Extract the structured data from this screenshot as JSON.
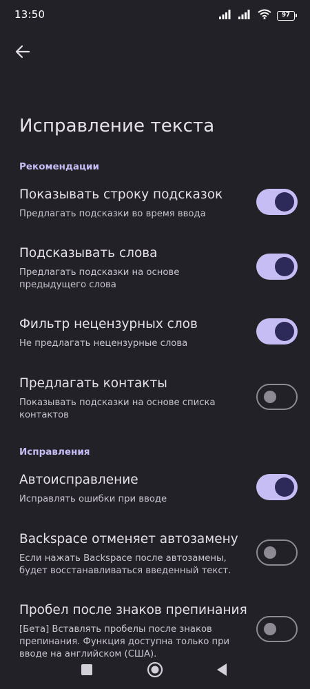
{
  "status_bar": {
    "time": "13:50",
    "battery": "97",
    "icons": [
      "signal-icon",
      "signal-icon",
      "wifi-icon",
      "battery-icon"
    ]
  },
  "header": {
    "back_icon": "arrow-left-icon",
    "title": "Исправление текста"
  },
  "sections": [
    {
      "header": "Рекомендации",
      "items": [
        {
          "title": "Показывать строку подсказок",
          "subtitle": "Предлагать подсказки во время ввода",
          "enabled": true
        },
        {
          "title": "Подсказывать слова",
          "subtitle": "Предлагать подсказки на основе предыдущего слова",
          "enabled": true
        },
        {
          "title": "Фильтр нецензурных слов",
          "subtitle": "Не предлагать нецензурные слова",
          "enabled": true
        },
        {
          "title": "Предлагать контакты",
          "subtitle": "Показывать подсказки на основе списка контактов",
          "enabled": false
        }
      ]
    },
    {
      "header": "Исправления",
      "items": [
        {
          "title": "Автоисправление",
          "subtitle": "Исправлять ошибки при вводе",
          "enabled": true
        },
        {
          "title": "Backspace отменяет автозамену",
          "subtitle": "Если нажать Backspace после автозамены, будет восстанавливаться введенный текст.",
          "enabled": false
        },
        {
          "title": "Пробел после знаков препинания",
          "subtitle": "[Бета] Вставлять пробелы после знаков препинания. Функция доступна только при вводе на английском (США).",
          "enabled": false
        }
      ]
    }
  ],
  "nav_bar": {
    "buttons": [
      "recents-square-icon",
      "home-circle-icon",
      "back-triangle-icon"
    ]
  },
  "colors": {
    "background": "#222127",
    "accent": "#c6bdf5",
    "toggle_knob_on": "#2d2a5a",
    "toggle_off": "#8e8a94"
  }
}
